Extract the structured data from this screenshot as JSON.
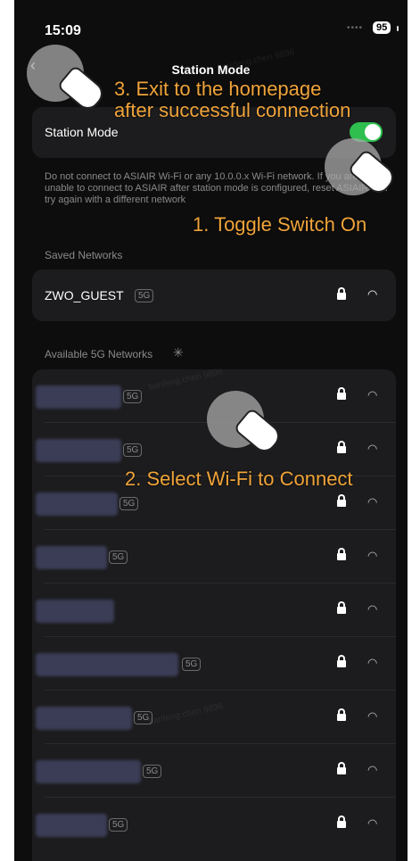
{
  "status_bar": {
    "time": "15:09",
    "battery": "95"
  },
  "nav": {
    "title": "Station Mode",
    "back_icon": "chevron-left-icon"
  },
  "station": {
    "label": "Station Mode",
    "toggle_on": true,
    "accent": "#2fbf4f"
  },
  "warning": "Do not connect to ASIAIR Wi-Fi or any 10.0.0.x Wi-Fi network. If you are unable to connect to ASIAIR after station mode is configured, reset ASIAIR and try again with a different network",
  "saved": {
    "title": "Saved Networks",
    "networks": [
      {
        "name": "ZWO_GUEST",
        "badge": "5G"
      }
    ]
  },
  "available": {
    "title": "Available 5G Networks",
    "badges": [
      "5G",
      "5G",
      "5G",
      "5G",
      "",
      "5G",
      "5G",
      "5G",
      "5G"
    ]
  },
  "annotations": {
    "step3_line1": "3.  Exit to the homepage",
    "step3_line2": "after successful connection",
    "step1": "1.  Toggle Switch On",
    "step2": "2.  Select Wi-Fi to Connect",
    "color": "#f0a43a"
  },
  "watermark": "tianfeng.chen 9896"
}
